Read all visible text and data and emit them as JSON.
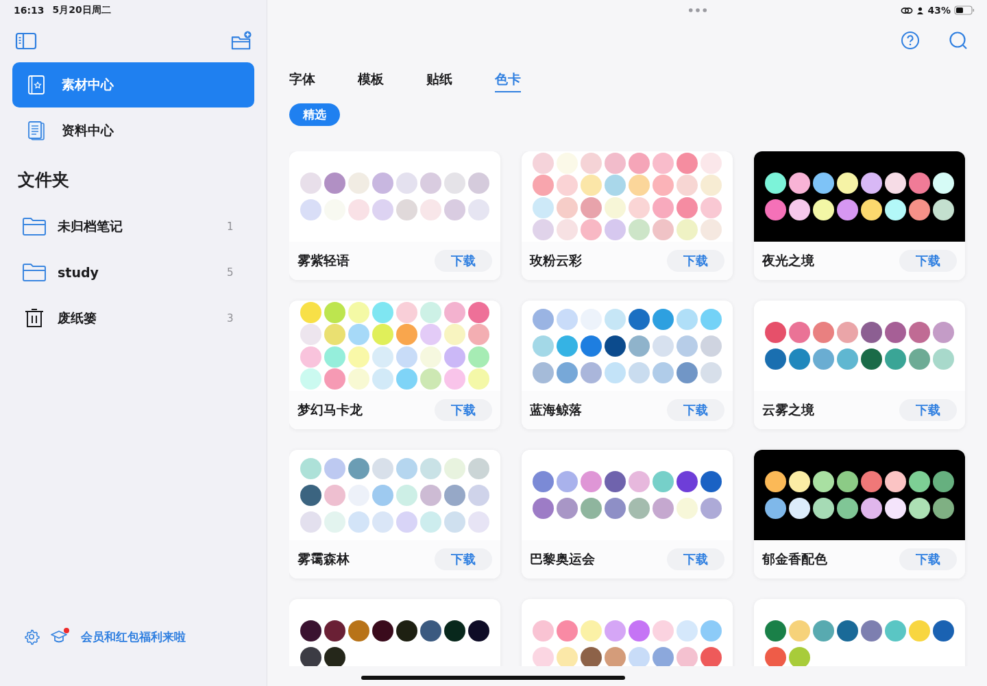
{
  "status_bar": {
    "time": "16:13",
    "date": "5月20日周二",
    "battery": "43%"
  },
  "sidebar": {
    "nav": [
      {
        "label": "素材中心",
        "kind": "material",
        "selected": true
      },
      {
        "label": "资料中心",
        "kind": "document",
        "selected": false
      }
    ],
    "section_title": "文件夹",
    "folders": [
      {
        "name": "未归档笔记",
        "count": "1",
        "kind": "folder"
      },
      {
        "name": "study",
        "count": "5",
        "kind": "folder"
      },
      {
        "name": "废纸篓",
        "count": "3",
        "kind": "trash"
      }
    ],
    "promo": "会员和红包福利来啦"
  },
  "tabs": [
    {
      "label": "字体",
      "selected": false
    },
    {
      "label": "模板",
      "selected": false
    },
    {
      "label": "贴纸",
      "selected": false
    },
    {
      "label": "色卡",
      "selected": true
    }
  ],
  "filters": [
    {
      "label": "精选",
      "selected": true
    }
  ],
  "cards": [
    {
      "name": "雾紫轻语",
      "dark": false,
      "button": "下载",
      "rows": [
        [
          {
            "color": "#e8dfea"
          },
          {
            "color": "#b190c4"
          },
          {
            "color": "#f1ece3"
          },
          {
            "color": "#c8b7e0"
          },
          {
            "color": "#e4e1ef"
          },
          {
            "color": "#d9cce0"
          },
          {
            "color": "#e5e3e8"
          },
          {
            "color": "#d5cbdc"
          }
        ],
        [
          {
            "color": "#d9def7"
          },
          {
            "color": "#f8f9f1"
          },
          {
            "color": "#f9e1e6"
          },
          {
            "color": "#ddd3f2"
          },
          {
            "color": "#e0d9da"
          },
          {
            "color": "#f8e6e9"
          },
          {
            "color": "#d9cce1"
          },
          {
            "color": "#e6e5f2"
          }
        ]
      ]
    },
    {
      "name": "玫粉云彩",
      "dark": false,
      "button": "下载",
      "rows": [
        [
          {
            "color": "#f5d3da"
          },
          {
            "color": "#fbf9e8"
          },
          {
            "color": "#f5d3d6"
          },
          {
            "color": "#f2bccb"
          },
          {
            "color": "#f5a5b8"
          },
          {
            "color": "#f9bccb"
          },
          {
            "color": "#f58da0"
          },
          {
            "color": "#fbe7ea"
          }
        ],
        [
          {
            "color": "#f8a5ad"
          },
          {
            "color": "#fad3d5"
          },
          {
            "color": "#fbe6a8"
          },
          {
            "color": "#a9d7ea"
          },
          {
            "color": "#fbd69a"
          },
          {
            "color": "#fbb3b8"
          },
          {
            "color": "#f7d6d3"
          },
          {
            "color": "#f7ecd3"
          }
        ],
        [
          {
            "color": "#cde9f8"
          },
          {
            "color": "#f6cdc8"
          },
          {
            "color": "#e8a3ab"
          },
          {
            "color": "#f7f6d7"
          },
          {
            "color": "#fad5d5"
          },
          {
            "color": "#f8aabd"
          },
          {
            "color": "#f58ca2"
          },
          {
            "color": "#f9c8d3"
          }
        ],
        [
          {
            "color": "#e0d3ea"
          },
          {
            "color": "#f7e1e3"
          },
          {
            "color": "#f8b8c4"
          },
          {
            "color": "#d6c8ef"
          },
          {
            "color": "#cde5c8"
          },
          {
            "color": "#f0c3c6"
          },
          {
            "color": "#eff2c4"
          },
          {
            "color": "#f5e8e0"
          }
        ]
      ]
    },
    {
      "name": "夜光之境",
      "dark": true,
      "button": "下载",
      "rows": [
        [
          {
            "color": "#7cf3d9"
          },
          {
            "color": "#f8b3d6"
          },
          {
            "color": "#7ec3f7"
          },
          {
            "color": "#f6f3a6"
          },
          {
            "color": "#d8b8f6"
          },
          {
            "color": "#f6dce6"
          },
          {
            "color": "#f07b97"
          },
          {
            "color": "#d6fbf6"
          }
        ],
        [
          {
            "color": "#f571b8"
          },
          {
            "color": "#f6c8ec"
          },
          {
            "color": "#f3f7a6"
          },
          {
            "color": "#d697f2"
          },
          {
            "color": "#fbd96e"
          },
          {
            "color": "#b3f8f8"
          },
          {
            "color": "#f59188"
          },
          {
            "color": "#c4e0cf"
          }
        ]
      ]
    },
    {
      "name": "梦幻马卡龙",
      "dark": false,
      "button": "下载",
      "rows": [
        [
          {
            "color": "#f8e047"
          },
          {
            "color": "#bde54f"
          },
          {
            "color": "#f4f9a5"
          },
          {
            "color": "#7fe6f2"
          },
          {
            "color": "#f9cfd8"
          },
          {
            "color": "#cdf1e6"
          },
          {
            "color": "#f3b2cf"
          },
          {
            "color": "#ee7098"
          }
        ],
        [
          {
            "color": "#ede5ee"
          },
          {
            "color": "#eae071"
          },
          {
            "color": "#a6d9f8"
          },
          {
            "color": "#e0ef5a"
          },
          {
            "color": "#f9a64d"
          },
          {
            "color": "#e3cbf7"
          },
          {
            "color": "#f8f4c0"
          },
          {
            "color": "#f3aeb2"
          }
        ],
        [
          {
            "color": "#f9c3dc"
          },
          {
            "color": "#95eedb"
          },
          {
            "color": "#f9f8a8"
          },
          {
            "color": "#d9ecf8"
          },
          {
            "color": "#c8dcf8"
          },
          {
            "color": "#f6f8df"
          },
          {
            "color": "#cbb8f7"
          },
          {
            "color": "#a6ecb4"
          }
        ],
        [
          {
            "color": "#cbfaf0"
          },
          {
            "color": "#f69ab4"
          },
          {
            "color": "#f8f9d3"
          },
          {
            "color": "#d2eaf8"
          },
          {
            "color": "#7fd4f7"
          },
          {
            "color": "#cde8b3"
          },
          {
            "color": "#f9c4ea"
          },
          {
            "color": "#f4f8a8"
          }
        ]
      ]
    },
    {
      "name": "蓝海鲸落",
      "dark": false,
      "button": "下载",
      "rows": [
        [
          {
            "color": "#9ab4e3"
          },
          {
            "color": "#c9dcf9"
          },
          {
            "color": "#edf3fb"
          },
          {
            "color": "#c6e6f6"
          },
          {
            "color": "#1a6fc2"
          },
          {
            "color": "#2ea0e0"
          },
          {
            "color": "#b0dff8"
          },
          {
            "color": "#73d2f7"
          }
        ],
        [
          {
            "color": "#a3d8e7"
          },
          {
            "color": "#35b3e4"
          },
          {
            "color": "#1e7ee0"
          },
          {
            "color": "#0c4b8d"
          },
          {
            "color": "#8fb3cb"
          },
          {
            "color": "#d7e1ef"
          },
          {
            "color": "#b7cde8"
          },
          {
            "color": "#cfd4e0"
          }
        ],
        [
          {
            "color": "#a5bbd9"
          },
          {
            "color": "#77a8d8"
          },
          {
            "color": "#aab6db"
          },
          {
            "color": "#c3e3f8"
          },
          {
            "color": "#c9dcef"
          },
          {
            "color": "#b0cce9"
          },
          {
            "color": "#7196c6"
          },
          {
            "color": "#d7dfea"
          }
        ]
      ]
    },
    {
      "name": "云雾之境",
      "dark": false,
      "button": "下载",
      "rows": [
        [
          {
            "color": "#e6506a"
          },
          {
            "color": "#ea7396"
          },
          {
            "color": "#e98080"
          },
          {
            "color": "#eaa5a8"
          },
          {
            "color": "#8c5f92"
          },
          {
            "color": "#a65f96"
          },
          {
            "color": "#c06b94"
          },
          {
            "color": "#c49cc7"
          }
        ],
        [
          {
            "color": "#1a6fb0"
          },
          {
            "color": "#1f88bd"
          },
          {
            "color": "#6aadd2"
          },
          {
            "color": "#5fb7d1"
          },
          {
            "color": "#1a6b48"
          },
          {
            "color": "#3aa596"
          },
          {
            "color": "#6dab95"
          },
          {
            "color": "#a8d9cb"
          }
        ]
      ]
    },
    {
      "name": "雾霭森林",
      "dark": false,
      "button": "下载",
      "rows": [
        [
          {
            "color": "#ade1d8"
          },
          {
            "color": "#bdc9f1"
          },
          {
            "color": "#6b9db4"
          },
          {
            "color": "#d8e0ea"
          },
          {
            "color": "#b5d6ef"
          },
          {
            "color": "#c9e2e6"
          },
          {
            "color": "#e8f3df"
          },
          {
            "color": "#cbd5d6"
          }
        ],
        [
          {
            "color": "#3b6480"
          },
          {
            "color": "#eebfd0"
          },
          {
            "color": "#edf1f9"
          },
          {
            "color": "#9ecaf0"
          },
          {
            "color": "#cdefe6"
          },
          {
            "color": "#cdbbd4"
          },
          {
            "color": "#96a8c7"
          },
          {
            "color": "#cfd3ea"
          }
        ],
        [
          {
            "color": "#e3e0ee"
          },
          {
            "color": "#e3f4ef"
          },
          {
            "color": "#d3e4f8"
          },
          {
            "color": "#dae6f7"
          },
          {
            "color": "#d8d4f7"
          },
          {
            "color": "#cdedee"
          },
          {
            "color": "#cfe0ef"
          },
          {
            "color": "#e7e4f5"
          }
        ]
      ]
    },
    {
      "name": "巴黎奥运会",
      "dark": false,
      "button": "下载",
      "rows": [
        [
          {
            "color": "#7b8ad6"
          },
          {
            "color": "#a9b2ec"
          },
          {
            "color": "#df96d6"
          },
          {
            "color": "#6f63ad"
          },
          {
            "color": "#e7b8dd"
          },
          {
            "color": "#76d0c9"
          },
          {
            "color": "#6e3ed8"
          },
          {
            "color": "#1a62c4"
          }
        ],
        [
          {
            "color": "#9d7cc6"
          },
          {
            "color": "#a896c6"
          },
          {
            "color": "#8fb59e"
          },
          {
            "color": "#8e8fc6"
          },
          {
            "color": "#a4bcae"
          },
          {
            "color": "#c5a8cf"
          },
          {
            "color": "#f7f7d9"
          },
          {
            "color": "#adaad7"
          }
        ]
      ]
    },
    {
      "name": "郁金香配色",
      "dark": true,
      "button": "下载",
      "rows": [
        [
          {
            "color": "#fbb957"
          },
          {
            "color": "#fbeda5"
          },
          {
            "color": "#a9e0a2"
          },
          {
            "color": "#8ccb86"
          },
          {
            "color": "#f07878"
          },
          {
            "color": "#fbc4c4"
          },
          {
            "color": "#7dcf95"
          },
          {
            "color": "#66b07f"
          }
        ],
        [
          {
            "color": "#7fb8ea"
          },
          {
            "color": "#dcecfb"
          },
          {
            "color": "#a6dbb5"
          },
          {
            "color": "#80c696"
          },
          {
            "color": "#e0b6ec"
          },
          {
            "color": "#f4e4fb"
          },
          {
            "color": "#ace0b4"
          },
          {
            "color": "#7fb083"
          }
        ]
      ]
    },
    {
      "dark": false,
      "rows": [
        [
          {
            "color": "#3a1230"
          },
          {
            "color": "#6a2035"
          },
          {
            "color": "#b87318"
          },
          {
            "color": "#3a0b1c"
          },
          {
            "color": "#1e2012"
          },
          {
            "color": "#3b5a80"
          },
          {
            "color": "#08281c"
          },
          {
            "color": "#0e0c26"
          }
        ],
        [
          {
            "color": "#3c3c44"
          },
          {
            "color": "#25271a"
          }
        ]
      ]
    },
    {
      "dark": false,
      "rows": [
        [
          {
            "color": "#f9c3d3"
          },
          {
            "color": "#f98aa4"
          },
          {
            "color": "#fbf1a6"
          },
          {
            "color": "#d5a6f6"
          },
          {
            "color": "#c574f5"
          },
          {
            "color": "#fbd3e0"
          },
          {
            "color": "#d5e8fb"
          },
          {
            "color": "#8ccbf8"
          }
        ],
        [
          {
            "color": "#fbd6e2"
          },
          {
            "color": "#fbe8a8"
          },
          {
            "color": "#8d6248"
          },
          {
            "color": "#d49c7a"
          },
          {
            "color": "#c8dcf8"
          },
          {
            "color": "#8ca8dc"
          },
          {
            "color": "#f4c1d0"
          },
          {
            "color": "#ee5a5a"
          }
        ]
      ]
    },
    {
      "dark": false,
      "rows": [
        [
          {
            "color": "#1a8048"
          },
          {
            "color": "#f6d27a"
          },
          {
            "color": "#58aab0"
          },
          {
            "color": "#1a6a98"
          },
          {
            "color": "#7d7fb0"
          },
          {
            "color": "#5ac6c4"
          },
          {
            "color": "#f8d640"
          },
          {
            "color": "#1a62b2"
          }
        ],
        [
          {
            "color": "#ee5c48"
          },
          {
            "color": "#a8cc3a"
          }
        ]
      ]
    }
  ]
}
